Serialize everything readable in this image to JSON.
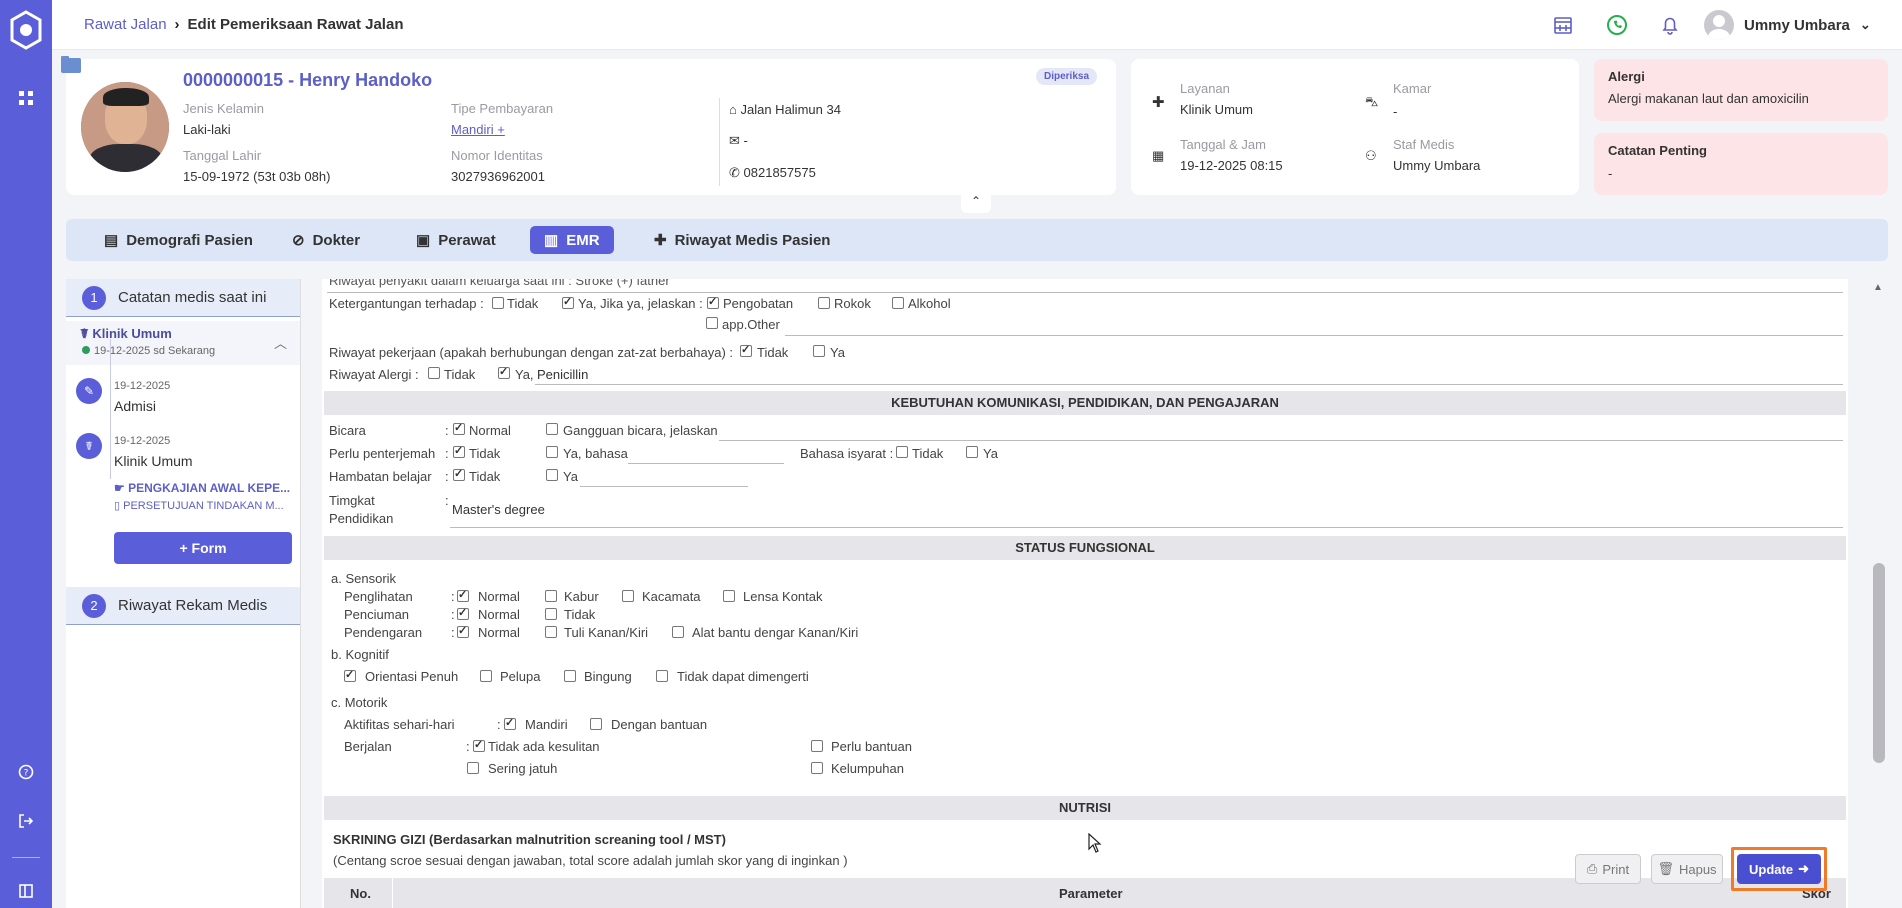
{
  "breadcrumb": {
    "parent": "Rawat Jalan",
    "current": "Edit Pemeriksaan Rawat Jalan"
  },
  "user": {
    "name": "Ummy Umbara"
  },
  "patient": {
    "id_name": "0000000015 - Henry Handoko",
    "status": "Diperiksa",
    "gender_label": "Jenis Kelamin",
    "gender": "Laki-laki",
    "dob_label": "Tanggal Lahir",
    "dob": "15-09-1972 (53t 03b 08h)",
    "payment_label": "Tipe Pembayaran",
    "payment": "Mandiri +",
    "idnum_label": "Nomor Identitas",
    "idnum": "3027936962001",
    "address": "Jalan Halimun 34",
    "email": "-",
    "phone": "0821857575"
  },
  "visit": {
    "service_label": "Layanan",
    "service": "Klinik Umum",
    "room_label": "Kamar",
    "room": "-",
    "datetime_label": "Tanggal & Jam",
    "datetime": "19-12-2025 08:15",
    "staff_label": "Staf Medis",
    "staff": "Ummy Umbara"
  },
  "alerts": {
    "allergy_label": "Alergi",
    "allergy": "Alergi makanan laut dan amoxicilin",
    "note_label": "Catatan Penting",
    "note": "-"
  },
  "tabs": [
    "Demografi Pasien",
    "Dokter",
    "Perawat",
    "EMR",
    "Riwayat Medis Pasien"
  ],
  "left": {
    "section1": "Catatan medis saat ini",
    "clinic": "Klinik Umum",
    "clinic_range": "19-12-2025 sd Sekarang",
    "ev1_date": "19-12-2025",
    "ev1": "Admisi",
    "ev2_date": "19-12-2025",
    "ev2": "Klinik Umum",
    "doc1": "PENGKAJIAN AWAL KEPE...",
    "doc2": "PERSETUJUAN TINDAKAN M...",
    "form_btn": "Form",
    "section2": "Riwayat Rekam Medis"
  },
  "form": {
    "family_history": "Riwayat penyakit dalam keluarga saat ini : Stroke (+) father",
    "dependency_label": "Ketergantungan terhadap :",
    "tidak": "Tidak",
    "ya_jelaskan": "Ya, Jika ya, jelaskan :",
    "pengobatan": "Pengobatan",
    "rokok": "Rokok",
    "alkohol": "Alkohol",
    "other": "app.Other",
    "job_label": "Riwayat pekerjaan (apakah berhubungan dengan zat-zat berbahaya) :",
    "ya": "Ya",
    "allergy_label": "Riwayat Alergi :",
    "allergy_ya": "Ya,",
    "allergy_value": "Penicillin",
    "sec_komunikasi": "KEBUTUHAN KOMUNIKASI, PENDIDIKAN, DAN PENGAJARAN",
    "bicara": "Bicara",
    "normal": "Normal",
    "gangguan": "Gangguan bicara, jelaskan",
    "penterjemah": "Perlu penterjemah",
    "ya_bahasa": "Ya, bahasa",
    "isyarat": "Bahasa isyarat :",
    "hambatan": "Hambatan belajar",
    "tingkat1": "Timgkat",
    "tingkat2": "Pendidikan",
    "pendidikan": "Master's degree",
    "sec_fungsional": "STATUS FUNGSIONAL",
    "sensorik": "a. Sensorik",
    "penglihatan": "Penglihatan",
    "kabur": "Kabur",
    "kacamata": "Kacamata",
    "lensa": "Lensa Kontak",
    "penciuman": "Penciuman",
    "pendengaran": "Pendengaran",
    "tuli": "Tuli Kanan/Kiri",
    "alat": "Alat bantu dengar Kanan/Kiri",
    "kognitif": "b. Kognitif",
    "orientasi": "Orientasi Penuh",
    "pelupa": "Pelupa",
    "bingung": "Bingung",
    "tidak_dapat": "Tidak dapat dimengerti",
    "motorik": "c. Motorik",
    "aktifitas": "Aktifitas sehari-hari",
    "mandiri": "Mandiri",
    "dengan_bantuan": "Dengan bantuan",
    "berjalan": "Berjalan",
    "tidak_kesulitan": "Tidak ada kesulitan",
    "perlu_bantuan": "Perlu bantuan",
    "sering_jatuh": "Sering jatuh",
    "kelumpuhan": "Kelumpuhan",
    "sec_nutrisi": "NUTRISI",
    "skrining": "SKRINING GIZI (Berdasarkan malnutrition screaning tool / MST)",
    "skrining_note": "(Centang scroe sesuai dengan jawaban, total score adalah jumlah skor yang di inginkan )",
    "col_no": "No.",
    "col_param": "Parameter",
    "col_skor": "Skor"
  },
  "actions": {
    "print": "Print",
    "hapus": "Hapus",
    "update": "Update"
  }
}
